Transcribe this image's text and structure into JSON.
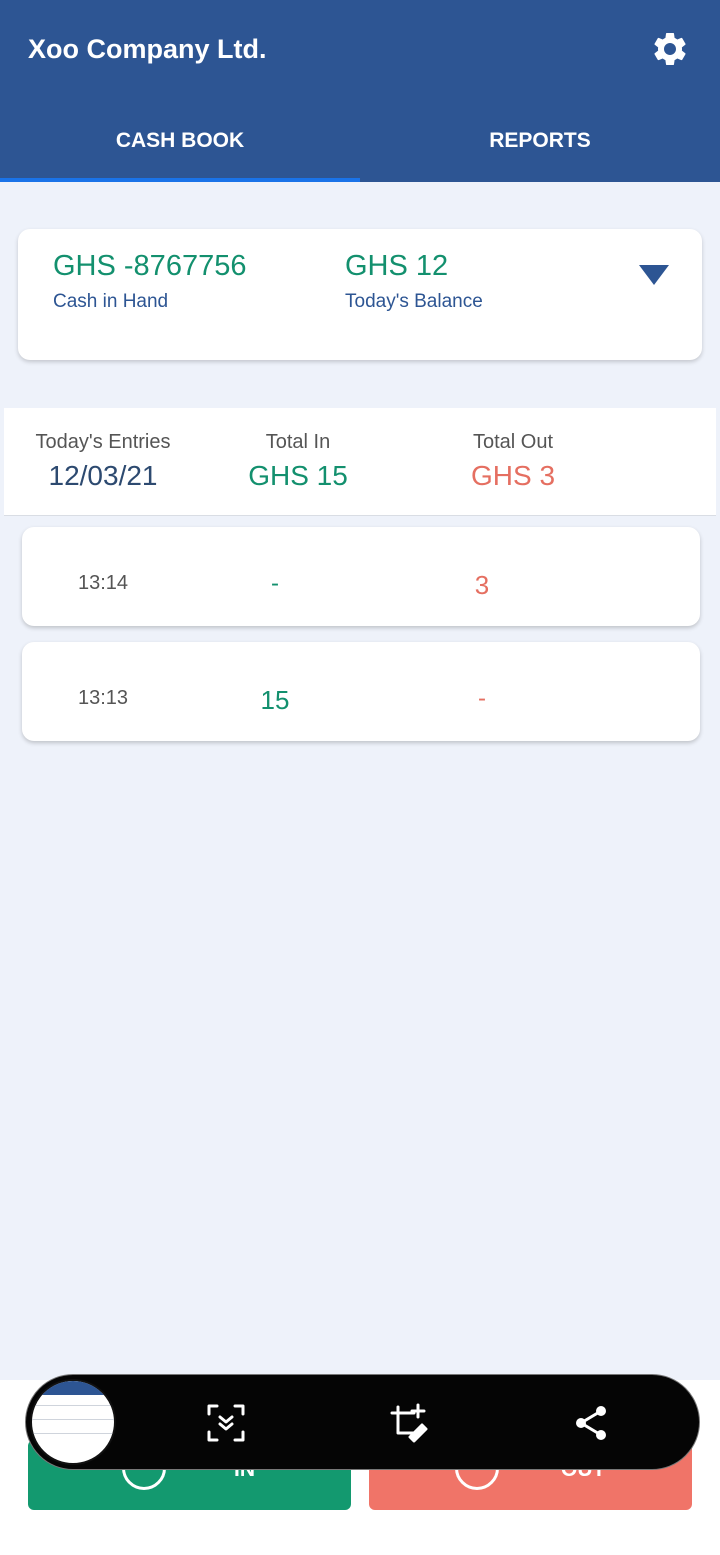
{
  "header": {
    "title": "Xoo Company Ltd.",
    "settings_icon": "gear-icon",
    "tabs": [
      {
        "label": "CASH BOOK",
        "active": true
      },
      {
        "label": "REPORTS",
        "active": false
      }
    ]
  },
  "balance": {
    "cash_in_hand": {
      "amount": "GHS -8767756",
      "label": "Cash in Hand"
    },
    "todays_balance": {
      "amount": "GHS 12",
      "label": "Today's Balance"
    },
    "expand_icon": "triangle-down-icon"
  },
  "summary": {
    "entries_label": "Today's Entries",
    "date": "12/03/21",
    "total_in_label": "Total In",
    "total_in": "GHS 15",
    "total_out_label": "Total Out",
    "total_out": "GHS 3"
  },
  "entries": [
    {
      "time": "13:14",
      "in": "-",
      "out": "3"
    },
    {
      "time": "13:13",
      "in": "15",
      "out": "-"
    }
  ],
  "actions": {
    "in_label": "IN",
    "out_label": "OUT"
  },
  "screenshot_toolbar": {
    "tools": [
      "scroll-capture-icon",
      "crop-edit-icon",
      "share-icon"
    ]
  },
  "colors": {
    "primary": "#2d5593",
    "in_green": "#13906e",
    "out_red": "#e56f61",
    "background": "#eef2fa"
  }
}
